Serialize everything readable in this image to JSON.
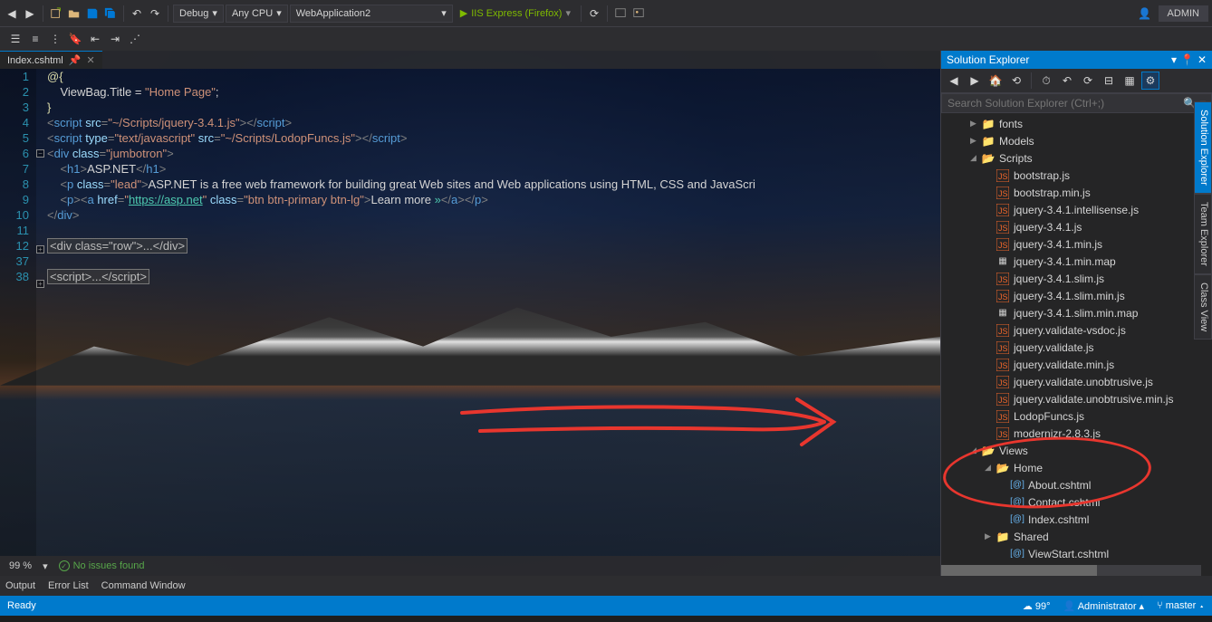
{
  "toolbar": {
    "config": "Debug",
    "platform": "Any CPU",
    "project": "WebApplication2",
    "run": "IIS Express (Firefox)",
    "admin": "ADMIN"
  },
  "tab": {
    "name": "Index.cshtml"
  },
  "code": {
    "lines": [
      "1",
      "2",
      "3",
      "4",
      "5",
      "6",
      "7",
      "8",
      "9",
      "10",
      "11",
      "12",
      "37",
      "38"
    ],
    "l1": "@{",
    "l2_a": "ViewBag.Title = ",
    "l2_b": "\"Home Page\"",
    "l2_c": ";",
    "l3": "}",
    "l4_src": "\"~/Scripts/jquery-3.4.1.js\"",
    "l5_type": "\"text/javascript\"",
    "l5_src": "\"~/Scripts/LodopFuncs.js\"",
    "l6_class": "\"jumbotron\"",
    "l7_txt": "ASP.NET",
    "l8_class": "\"lead\"",
    "l8_txt": "ASP.NET is a free web framework for building great Web sites and Web applications using HTML, CSS and JavaScri",
    "l9_href": "\"https://asp.net\"",
    "l9_class": "\"btn btn-primary btn-lg\"",
    "l9_txt": "Learn more ",
    "l9_raquo": "&raquo;",
    "l12": "<div class=\"row\">...</div>",
    "l38": "<script>...</script"
  },
  "status": {
    "zoom": "99 %",
    "issues": "No issues found"
  },
  "solexp": {
    "title": "Solution Explorer",
    "search": "Search Solution Explorer (Ctrl+;)",
    "items": [
      {
        "depth": 2,
        "type": "folder",
        "arrow": "▶",
        "label": "fonts"
      },
      {
        "depth": 2,
        "type": "folder",
        "arrow": "▶",
        "label": "Models"
      },
      {
        "depth": 2,
        "type": "folder-open",
        "arrow": "◢",
        "label": "Scripts"
      },
      {
        "depth": 3,
        "type": "js",
        "label": "bootstrap.js"
      },
      {
        "depth": 3,
        "type": "js",
        "label": "bootstrap.min.js"
      },
      {
        "depth": 3,
        "type": "js",
        "label": "jquery-3.4.1.intellisense.js"
      },
      {
        "depth": 3,
        "type": "js",
        "label": "jquery-3.4.1.js"
      },
      {
        "depth": 3,
        "type": "js",
        "label": "jquery-3.4.1.min.js"
      },
      {
        "depth": 3,
        "type": "map",
        "label": "jquery-3.4.1.min.map"
      },
      {
        "depth": 3,
        "type": "js",
        "label": "jquery-3.4.1.slim.js"
      },
      {
        "depth": 3,
        "type": "js",
        "label": "jquery-3.4.1.slim.min.js"
      },
      {
        "depth": 3,
        "type": "map",
        "label": "jquery-3.4.1.slim.min.map"
      },
      {
        "depth": 3,
        "type": "js",
        "label": "jquery.validate-vsdoc.js"
      },
      {
        "depth": 3,
        "type": "js",
        "label": "jquery.validate.js"
      },
      {
        "depth": 3,
        "type": "js",
        "label": "jquery.validate.min.js"
      },
      {
        "depth": 3,
        "type": "js",
        "label": "jquery.validate.unobtrusive.js"
      },
      {
        "depth": 3,
        "type": "js",
        "label": "jquery.validate.unobtrusive.min.js"
      },
      {
        "depth": 3,
        "type": "js",
        "label": "LodopFuncs.js"
      },
      {
        "depth": 3,
        "type": "js",
        "label": "modernizr-2.8.3.js"
      },
      {
        "depth": 2,
        "type": "folder-open",
        "arrow": "◢",
        "label": "Views"
      },
      {
        "depth": 3,
        "type": "folder-open",
        "arrow": "◢",
        "label": "Home"
      },
      {
        "depth": 4,
        "type": "cshtml",
        "label": "About.cshtml"
      },
      {
        "depth": 4,
        "type": "cshtml",
        "label": "Contact.cshtml"
      },
      {
        "depth": 4,
        "type": "cshtml",
        "label": "Index.cshtml"
      },
      {
        "depth": 3,
        "type": "folder",
        "arrow": "▶",
        "label": "Shared"
      },
      {
        "depth": 4,
        "type": "cshtml",
        "label": "ViewStart.cshtml"
      }
    ]
  },
  "sidetabs": [
    "Solution Explorer",
    "Team Explorer",
    "Class View"
  ],
  "bottomtabs": [
    "Output",
    "Error List",
    "Command Window"
  ],
  "statusbar": {
    "ready": "Ready",
    "weather": "99°",
    "user": "Administrator",
    "branch": "master"
  }
}
